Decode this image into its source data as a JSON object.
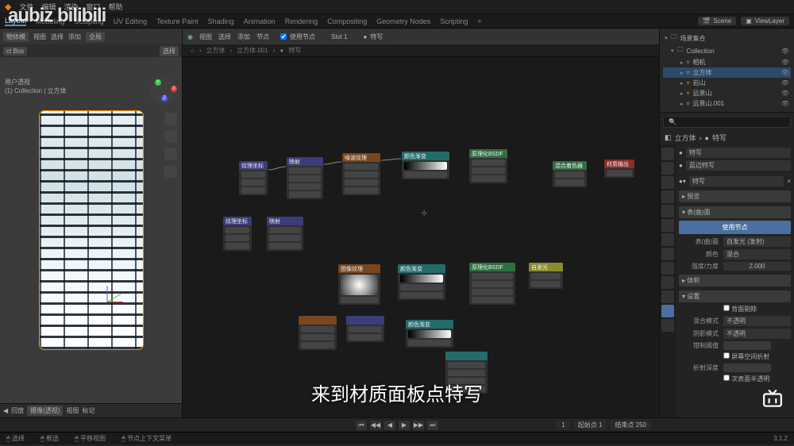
{
  "watermark": {
    "left": "aubiz",
    "right": "bilibili"
  },
  "subtitle": "来到材质面板点特写",
  "top_menu": [
    "文件",
    "编辑",
    "渲染",
    "窗口",
    "帮助"
  ],
  "workspace_tabs": [
    "Layout",
    "Modeling",
    "Sculpting",
    "UV Editing",
    "Texture Paint",
    "Shading",
    "Animation",
    "Rendering",
    "Compositing",
    "Geometry Nodes",
    "Scripting",
    "+"
  ],
  "scene_field": {
    "label": "Scene",
    "value": "Scene"
  },
  "layer_field": {
    "label": "ViewLayer",
    "value": "ViewLayer"
  },
  "viewport": {
    "header_menu": [
      "视图",
      "选择",
      "添加"
    ],
    "mode": "物体模",
    "ctx": "全局",
    "box": "ct Box",
    "overlay_label": "户透视",
    "info_line1": "用户透视",
    "info_line2": "(1) Collection | 立方体",
    "footer": {
      "play": "回放",
      "perspective": "摄像(透视)",
      "view": "视图",
      "mark": "标记"
    },
    "select_label": "选择"
  },
  "node_editor": {
    "menus": [
      "视图",
      "选择",
      "添加",
      "节点"
    ],
    "use_nodes": "使用节点",
    "slot": "Slot 1",
    "mat": "特写",
    "breadcrumb": [
      "立方体",
      "立方体.001",
      "特写"
    ]
  },
  "nodes": {
    "tex1": "纹理坐标",
    "map1": "映射",
    "noise1": "噪波纹理",
    "ramp1": "颜色渐变",
    "bsdf1": "原理化BSDF",
    "mix1": "混合着色器",
    "out1": "材质输出",
    "tex2": "纹理坐标",
    "map2": "映射",
    "imgtex": "图像纹理",
    "ramp2": "颜色渐变",
    "bsdf2": "原理化BSDF",
    "emit": "自发光"
  },
  "outliner": {
    "title": "场景集合",
    "collection": "Collection",
    "items": [
      {
        "name": "相机",
        "sel": false
      },
      {
        "name": "立方体",
        "sel": true
      },
      {
        "name": "岩山",
        "sel": false
      },
      {
        "name": "远景山",
        "sel": false
      },
      {
        "name": "远景山.001",
        "sel": false
      }
    ]
  },
  "properties": {
    "path": [
      "立方体",
      "特写"
    ],
    "mat_list": [
      {
        "name": "特写",
        "active": true
      },
      {
        "name": "蓝边特写",
        "active": false
      }
    ],
    "selector_value": "特写",
    "panels": {
      "preview": "预览",
      "surface": "表(曲)面"
    },
    "use_nodes_btn": "使用节点",
    "surface_row": {
      "k": "表(曲)面",
      "v": "自发光 (发射)"
    },
    "color_row": {
      "k": "颜色",
      "v": "混合"
    },
    "strength_row": {
      "k": "强度/力度",
      "v": "2.000"
    },
    "volume": "体积",
    "settings": "设置",
    "backface": "背面剔除",
    "blend": {
      "k": "混合模式",
      "v": "不透明"
    },
    "shadow": {
      "k": "阴影模式",
      "v": "不透明"
    },
    "clip": {
      "k": "钳制阈值",
      "v": ""
    },
    "ss": "屏幕空间折射",
    "refr": "折射深度",
    "subsurf": "次表面半透明"
  },
  "timeline": {
    "frame": "1",
    "start": "起始点 1",
    "end": "结束点 250",
    "ver": "3.1.2"
  },
  "status": {
    "sel": "选择",
    "box": "框选",
    "mid": "平移视图",
    "ctx": "节点上下文菜单"
  }
}
